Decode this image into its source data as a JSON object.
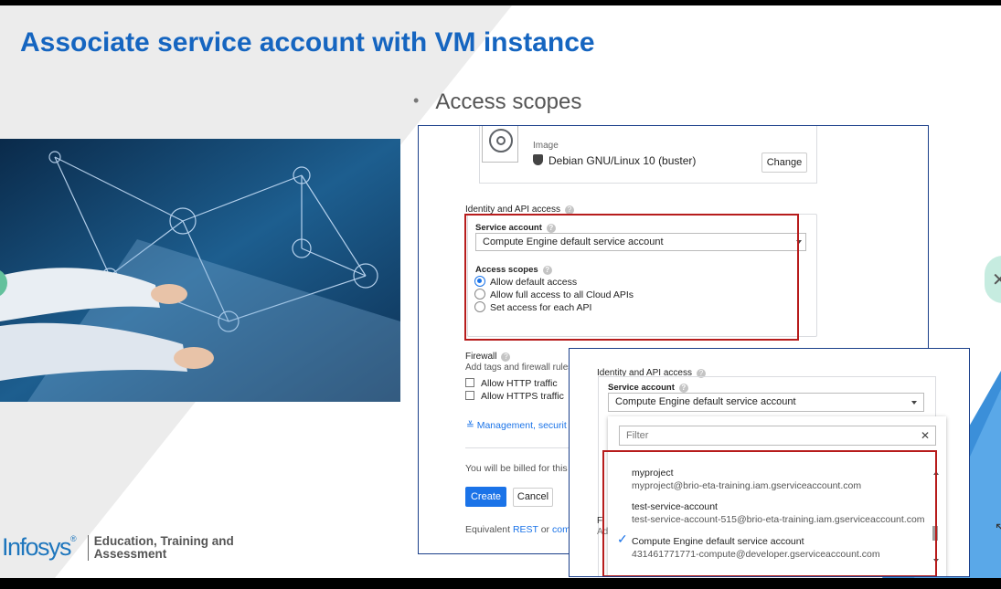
{
  "slide": {
    "title": "Associate service account with VM instance",
    "bullet": "Access scopes",
    "logo_word": "Infosys",
    "logo_reg": "®",
    "logo_line1": "Education, Training and",
    "logo_line2": "Assessment",
    "accent_color": "#1565c0",
    "highlight_color": "#b71c1c"
  },
  "console": {
    "image_label": "Image",
    "image_value": "Debian GNU/Linux 10 (buster)",
    "change_label": "Change",
    "identity_heading": "Identity and API access",
    "service_account_label": "Service account",
    "service_account_value": "Compute Engine default service account",
    "access_scopes_label": "Access scopes",
    "scope_options": [
      "Allow default access",
      "Allow full access to all Cloud APIs",
      "Set access for each API"
    ],
    "scope_selected": "Allow default access",
    "firewall_heading": "Firewall",
    "firewall_sub": "Add tags and firewall rules",
    "firewall_options": [
      "Allow HTTP traffic",
      "Allow HTTPS traffic"
    ],
    "management_link": "Management, securit",
    "billing_text": "You will be billed for this",
    "create_label": "Create",
    "cancel_label": "Cancel",
    "equivalent_prefix": "Equivalent",
    "rest_link": "REST",
    "or_text": "or",
    "command_link": "comm"
  },
  "dropdown_panel": {
    "identity_heading": "Identity and API access",
    "service_account_label": "Service account",
    "service_account_value": "Compute Engine default service account",
    "filter_placeholder": "Filter",
    "clear_glyph": "✕",
    "check_glyph": "✓",
    "accounts": [
      {
        "name": "myproject",
        "email": "myproject@brio-eta-training.iam.gserviceaccount.com"
      },
      {
        "name": "test-service-account",
        "email": "test-service-account-515@brio-eta-training.iam.gserviceaccount.com"
      },
      {
        "name": "Compute Engine default service account",
        "email": "431461771771-compute@developer.gserviceaccount.com"
      }
    ],
    "selected_account": "Compute Engine default service account",
    "peek_top": "Fi",
    "peek_bottom": "Ad"
  }
}
